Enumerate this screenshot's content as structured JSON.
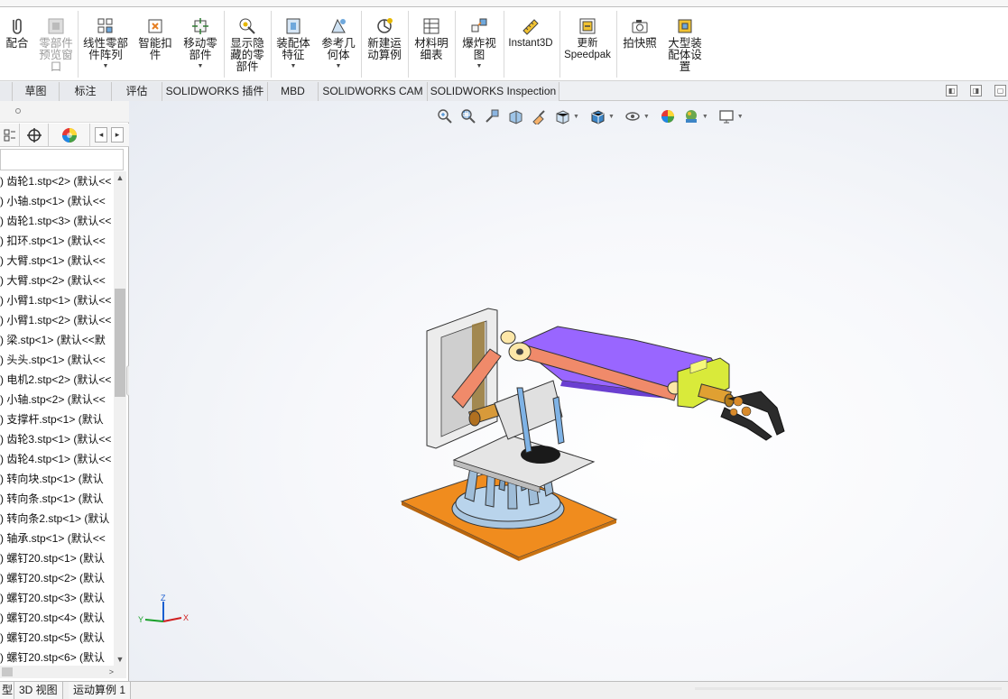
{
  "ribbon": {
    "buttons": [
      {
        "id": "mate",
        "label": "配合",
        "icon": "mate-paperclip-icon",
        "enabled": true,
        "dropdown": false
      },
      {
        "id": "preview",
        "label": "零部件\n预览窗\n口",
        "icon": "component-preview-icon",
        "enabled": false,
        "dropdown": false
      },
      {
        "id": "pattern",
        "label": "线性零部\n件阵列",
        "icon": "linear-pattern-icon",
        "enabled": true,
        "dropdown": true
      },
      {
        "id": "smart_fastener",
        "label": "智能扣\n件",
        "icon": "smart-fastener-icon",
        "enabled": true,
        "dropdown": false
      },
      {
        "id": "move_component",
        "label": "移动零\n部件",
        "icon": "move-component-icon",
        "enabled": true,
        "dropdown": true
      },
      {
        "id": "show_hidden",
        "label": "显示隐\n藏的零\n部件",
        "icon": "show-hidden-icon",
        "enabled": true,
        "dropdown": false
      },
      {
        "id": "assembly_feature",
        "label": "装配体\n特征",
        "icon": "assembly-feature-icon",
        "enabled": true,
        "dropdown": true
      },
      {
        "id": "ref_geometry",
        "label": "参考几\n何体",
        "icon": "reference-geometry-icon",
        "enabled": true,
        "dropdown": true
      },
      {
        "id": "new_motion",
        "label": "新建运\n动算例",
        "icon": "new-motion-study-icon",
        "enabled": true,
        "dropdown": false
      },
      {
        "id": "bom",
        "label": "材料明\n细表",
        "icon": "bill-of-materials-icon",
        "enabled": true,
        "dropdown": false
      },
      {
        "id": "exploded",
        "label": "爆炸视\n图",
        "icon": "exploded-view-icon",
        "enabled": true,
        "dropdown": true
      },
      {
        "id": "instant3d",
        "label": "Instant3D",
        "icon": "instant3d-icon",
        "enabled": true,
        "dropdown": false
      },
      {
        "id": "speedpak",
        "label": "更新\nSpeedpak",
        "icon": "speedpak-icon",
        "enabled": true,
        "dropdown": false
      },
      {
        "id": "snapshot",
        "label": "拍快照",
        "icon": "camera-icon",
        "enabled": true,
        "dropdown": false
      },
      {
        "id": "large_assembly",
        "label": "大型装\n配体设\n置",
        "icon": "large-assembly-icon",
        "enabled": true,
        "dropdown": false
      }
    ]
  },
  "tabs": [
    "",
    "草图",
    "标注",
    "评估",
    "SOLIDWORKS 插件",
    "MBD",
    "SOLIDWORKS CAM",
    "SOLIDWORKS Inspection"
  ],
  "feature_tree": {
    "items": [
      ") 齿轮1.stp<2> (默认<<",
      ") 小轴.stp<1> (默认<<",
      ") 齿轮1.stp<3> (默认<<",
      ") 扣环.stp<1> (默认<<",
      ") 大臂.stp<1> (默认<<",
      ") 大臂.stp<2> (默认<<",
      ") 小臂1.stp<1> (默认<<",
      ") 小臂1.stp<2> (默认<<",
      ") 梁.stp<1> (默认<<默",
      ") 头头.stp<1> (默认<<",
      ") 电机2.stp<2> (默认<<",
      ") 小轴.stp<2> (默认<<",
      ") 支撑杆.stp<1> (默认",
      ") 齿轮3.stp<1> (默认<<",
      ") 齿轮4.stp<1> (默认<<",
      ") 转向块.stp<1> (默认",
      ") 转向条.stp<1> (默认",
      ") 转向条2.stp<1> (默认",
      ") 轴承.stp<1> (默认<<",
      ") 螺钉20.stp<1> (默认",
      ") 螺钉20.stp<2> (默认",
      ") 螺钉20.stp<3> (默认",
      ") 螺钉20.stp<4> (默认",
      ") 螺钉20.stp<5> (默认",
      ") 螺钉20.stp<6> (默认"
    ]
  },
  "triad": {
    "x": "X",
    "y": "Y",
    "z": "Z"
  },
  "bottom_tabs": [
    "型",
    "3D 视图",
    "运动算例 1"
  ],
  "colors": {
    "base_plate": "#f08c1e",
    "turntable": "#a9c6e0",
    "frame": "#e8e8e8",
    "upper_arm": "#9966ff",
    "link_salmon": "#f08a6a",
    "gripper_block": "#d9ea3a",
    "gripper": "#d88a2a"
  }
}
